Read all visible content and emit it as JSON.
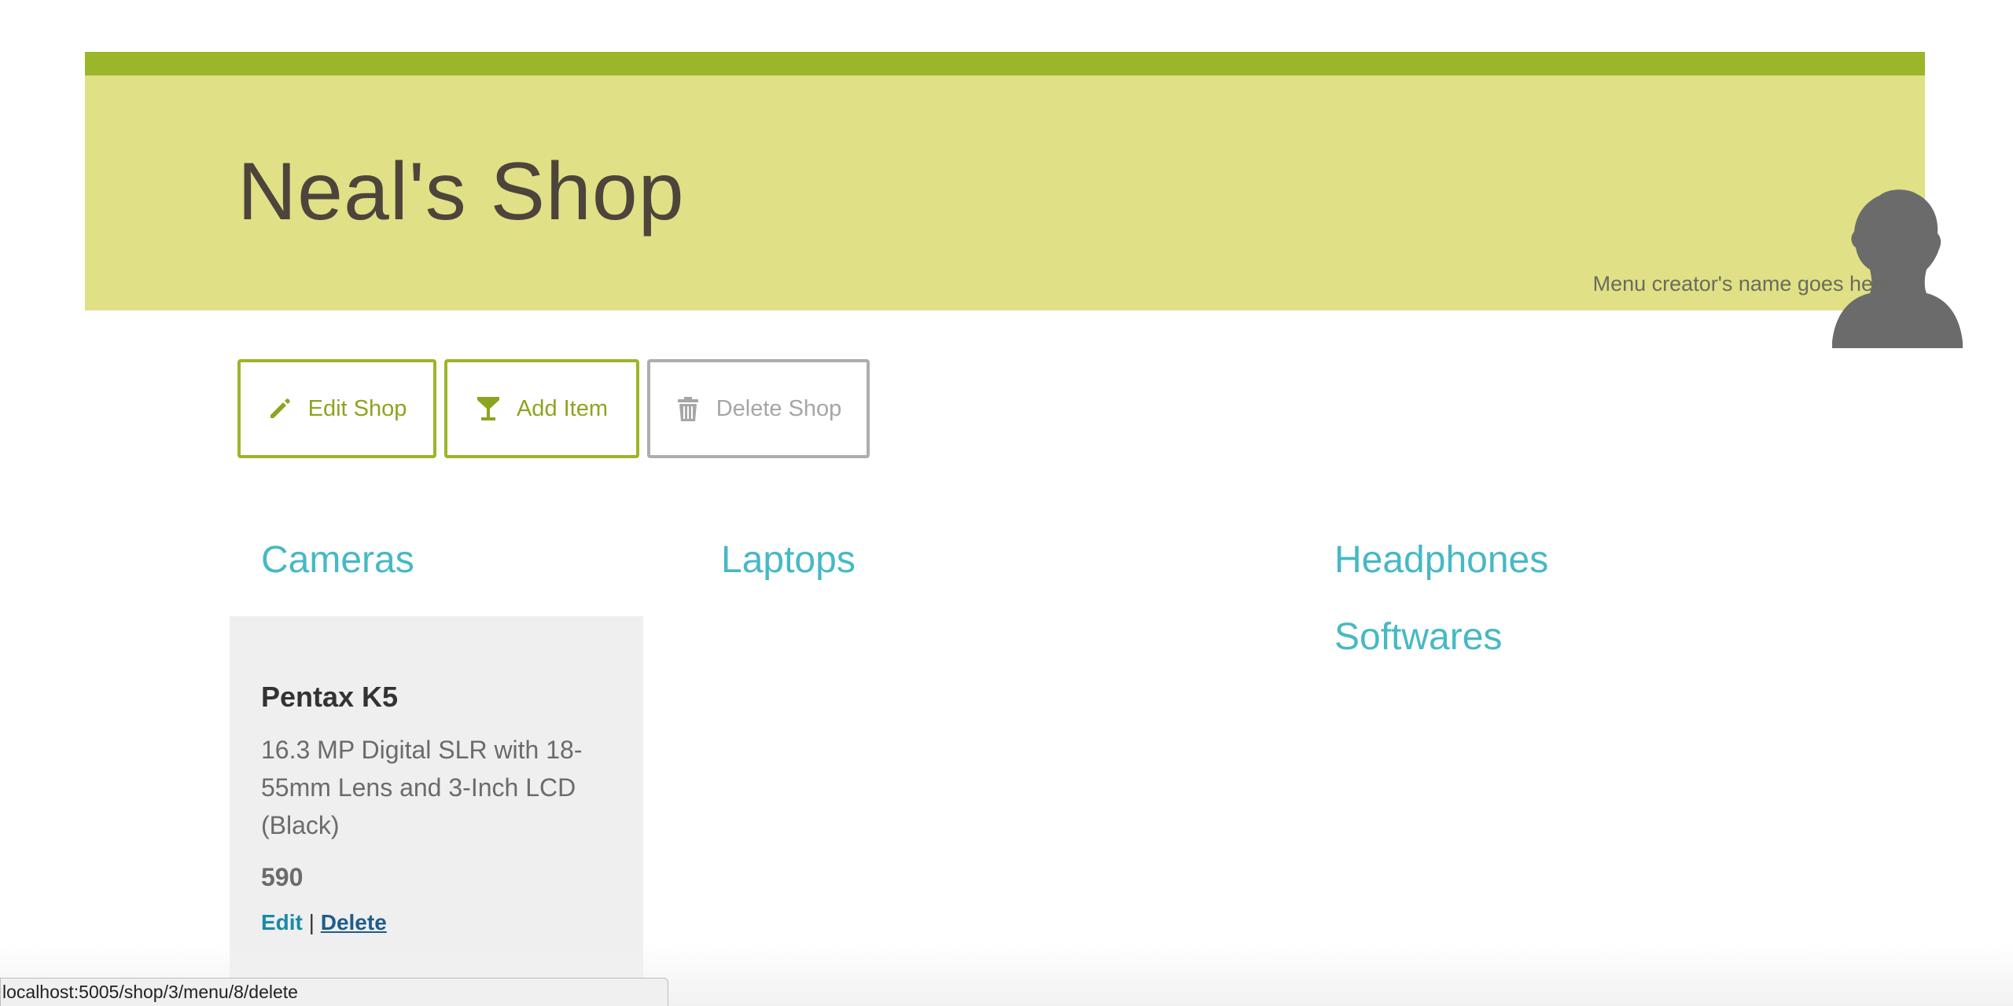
{
  "header": {
    "shop_name": "Neal's Shop",
    "creator_name": "Menu creator's name goes here"
  },
  "actions": {
    "edit_label": "Edit Shop",
    "add_label": "Add Item",
    "delete_label": "Delete Shop"
  },
  "categories": {
    "col1": [
      "Cameras"
    ],
    "col2": [
      "Laptops"
    ],
    "col3": [
      "Headphones",
      "Softwares"
    ]
  },
  "items": [
    {
      "name": "Pentax K5",
      "description": "16.3 MP Digital SLR with 18-55mm Lens and 3-Inch LCD (Black)",
      "price": "590",
      "edit_label": "Edit",
      "separator": "|",
      "delete_label": "Delete"
    }
  ],
  "status_bar": {
    "url": "localhost:5005/shop/3/menu/8/delete"
  },
  "colors": {
    "accent_green": "#9bb628",
    "banner": "#e0e086",
    "category": "#46b9c4"
  },
  "icons": {
    "edit": "pencil-icon",
    "add": "cocktail-glass-icon",
    "delete": "trash-icon",
    "avatar": "user-silhouette-icon"
  }
}
